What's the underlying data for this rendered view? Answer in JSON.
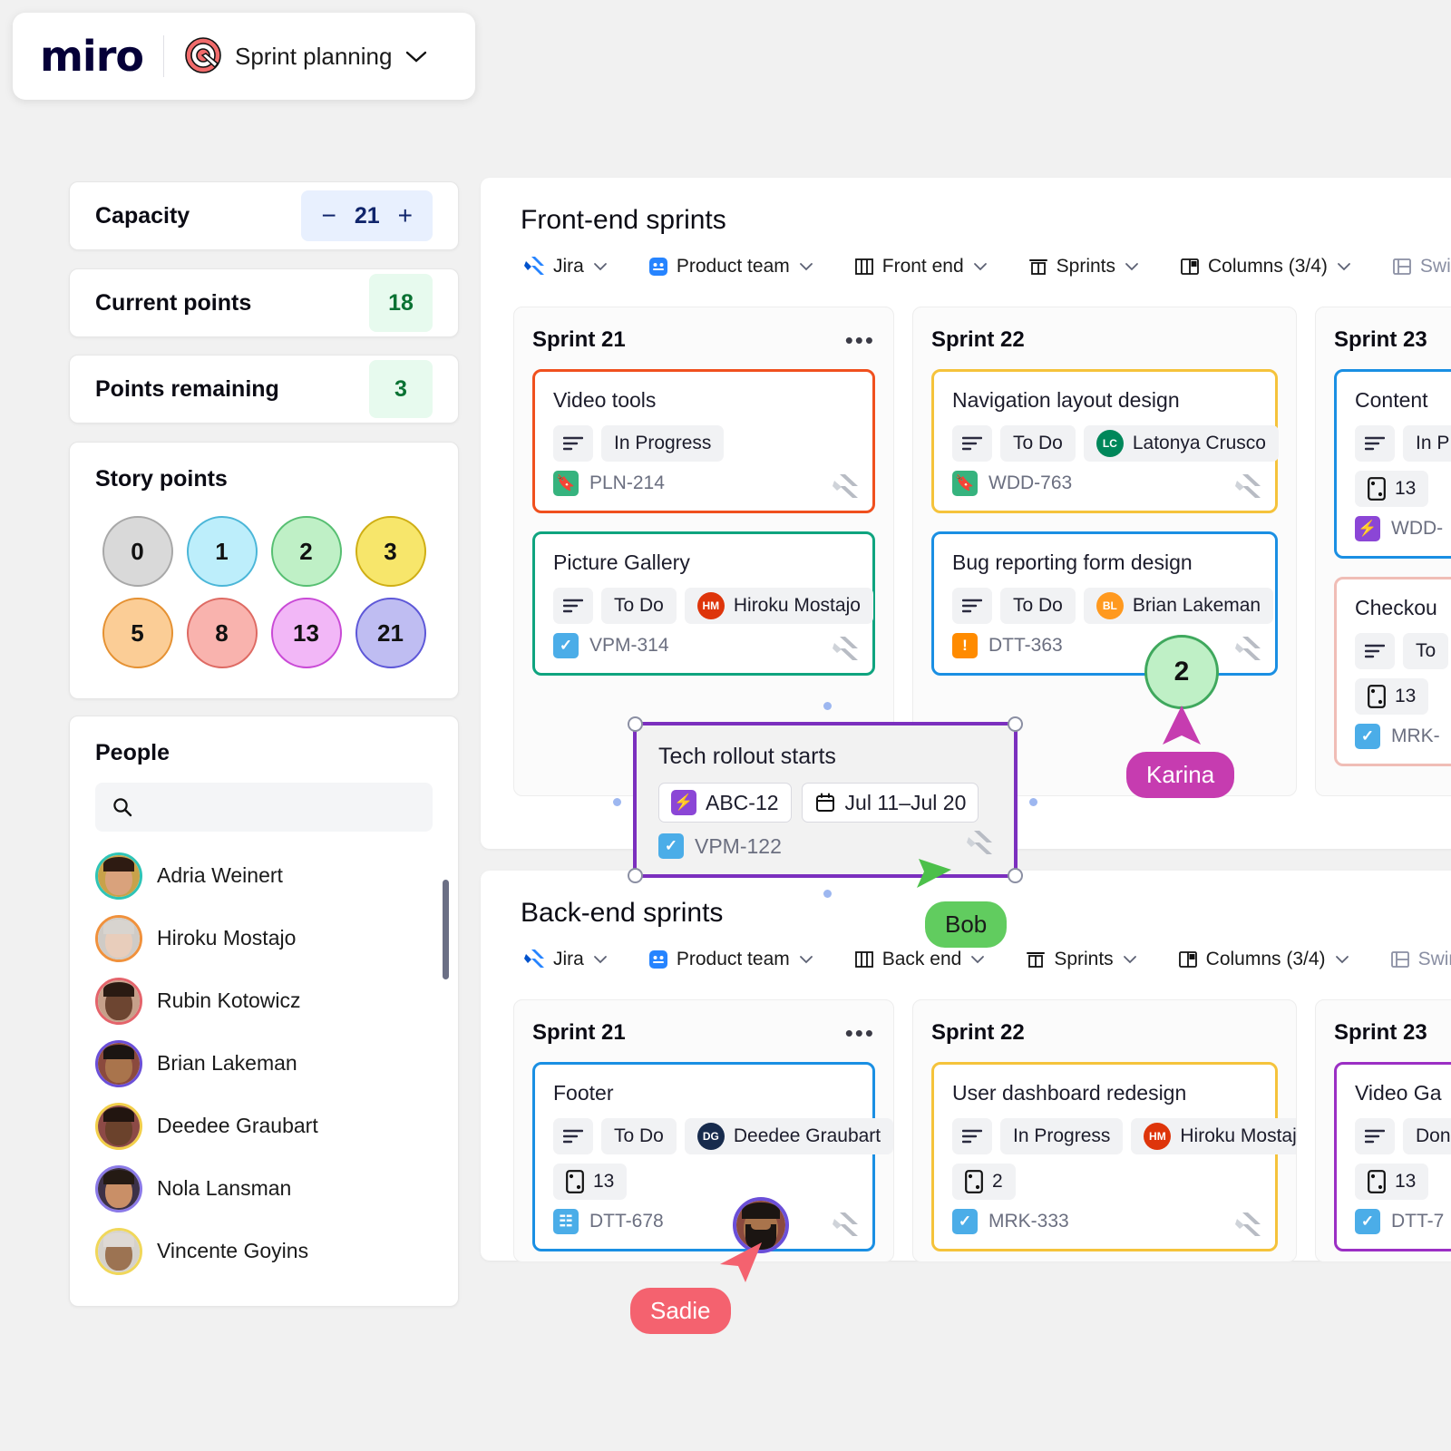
{
  "app": {
    "brand": "miro",
    "board_title": "Sprint planning",
    "board_icon": "target-icon",
    "chevron": "chevron-down-icon"
  },
  "sidebar": {
    "capacity": {
      "label": "Capacity",
      "value": "21",
      "minus": "−",
      "plus": "+"
    },
    "current_points": {
      "label": "Current points",
      "value": "18"
    },
    "points_remaining": {
      "label": "Points remaining",
      "value": "3"
    },
    "story_points": {
      "title": "Story points",
      "chips": [
        {
          "value": "0",
          "fill": "#d9d9d9",
          "stroke": "#a8a8a8"
        },
        {
          "value": "1",
          "fill": "#bdeefb",
          "stroke": "#4bb6d8"
        },
        {
          "value": "2",
          "fill": "#bff0c6",
          "stroke": "#57bf72"
        },
        {
          "value": "3",
          "fill": "#f7e66b",
          "stroke": "#cfae14"
        },
        {
          "value": "5",
          "fill": "#fbcd96",
          "stroke": "#e59132"
        },
        {
          "value": "8",
          "fill": "#f9b3ae",
          "stroke": "#de6a63"
        },
        {
          "value": "13",
          "fill": "#f2b7f7",
          "stroke": "#c94ad6"
        },
        {
          "value": "21",
          "fill": "#bfbdf2",
          "stroke": "#5d57d8"
        }
      ]
    },
    "people": {
      "title": "People",
      "search_placeholder": "",
      "search_value": "",
      "search_icon": "search-icon",
      "items": [
        {
          "name": "Adria Weinert",
          "ring": "#2ec4b6",
          "skin": "#d9a27c",
          "hair": "#2e1b12",
          "bg": "#c8a24a"
        },
        {
          "name": "Hiroku Mostajo",
          "ring": "#f0913c",
          "skin": "#e8cdbb",
          "hair": "#d8d4cf",
          "bg": "#cfcbc6"
        },
        {
          "name": "Rubin Kotowicz",
          "ring": "#e4646b",
          "skin": "#6d4531",
          "hair": "#2a1a12",
          "bg": "#c6a08a"
        },
        {
          "name": "Brian Lakeman",
          "ring": "#6b4fd8",
          "skin": "#a9744c",
          "hair": "#1b1512",
          "bg": "#8b4a3e"
        },
        {
          "name": "Deedee Graubart",
          "ring": "#f2cf4a",
          "skin": "#6b422c",
          "hair": "#221510",
          "bg": "#8c4a46"
        },
        {
          "name": "Nola Lansman",
          "ring": "#8b7ae8",
          "skin": "#c98f67",
          "hair": "#241a14",
          "bg": "#3c3147"
        },
        {
          "name": "Vincente Goyins",
          "ring": "#f0d75a",
          "skin": "#9c7352",
          "hair": "#ded9d4",
          "bg": "#d5d1cb"
        }
      ]
    }
  },
  "frames": [
    {
      "title": "Front-end sprints",
      "toolbar": [
        {
          "label": "Jira",
          "icon": "jira-icon",
          "muted": false
        },
        {
          "label": "Product team",
          "icon": "team-icon",
          "muted": false
        },
        {
          "label": "Front end",
          "icon": "board-icon",
          "muted": false
        },
        {
          "label": "Sprints",
          "icon": "sprints-icon",
          "muted": false
        },
        {
          "label": "Columns (3/4)",
          "icon": "columns-icon",
          "muted": false
        },
        {
          "label": "Swimlanes",
          "icon": "swimlanes-icon",
          "muted": true
        }
      ],
      "columns": [
        {
          "name": "Sprint 21",
          "menu": "•••",
          "cards": [
            {
              "title": "Video tools",
              "border": "#f0501e",
              "status": "In Progress",
              "assignee": null,
              "points": null,
              "key": "PLN-214",
              "key_icon": "story-icon",
              "key_icon_color": "#36b37e"
            },
            {
              "title": "Picture Gallery",
              "border": "#0fa47f",
              "status": "To Do",
              "assignee": {
                "name": "Hiroku Mostajo",
                "initials": "HM",
                "color": "#de350b"
              },
              "points": null,
              "key": "VPM-314",
              "key_icon": "task-icon",
              "key_icon_color": "#4bade8"
            }
          ]
        },
        {
          "name": "Sprint 22",
          "menu": "",
          "cards": [
            {
              "title": "Navigation layout design",
              "border": "#f5c33b",
              "status": "To Do",
              "assignee": {
                "name": "Latonya Crusco",
                "initials": "LC",
                "color": "#00875a"
              },
              "points": null,
              "key": "WDD-763",
              "key_icon": "story-icon",
              "key_icon_color": "#36b37e"
            },
            {
              "title": "Bug reporting form design",
              "border": "#1a8fe3",
              "status": "To Do",
              "assignee": {
                "name": "Brian Lakeman",
                "initials": "BL",
                "color": "#ff991f"
              },
              "points": null,
              "key": "DTT-363",
              "key_icon": "bug-icon",
              "key_icon_color": "#ff8b00"
            }
          ]
        },
        {
          "name": "Sprint 23",
          "menu": "",
          "cards": [
            {
              "title": "Content",
              "border": "#1a8fe3",
              "status": "In P",
              "assignee": null,
              "points": "13",
              "key": "WDD-",
              "key_icon": "epic-icon",
              "key_icon_color": "#8b46d6"
            },
            {
              "title": "Checkou",
              "border": "#f0bdb6",
              "status": "To",
              "assignee": null,
              "points": "13",
              "key": "MRK-",
              "key_icon": "task-icon",
              "key_icon_color": "#4bade8"
            }
          ]
        }
      ]
    },
    {
      "title": "Back-end sprints",
      "toolbar": [
        {
          "label": "Jira",
          "icon": "jira-icon",
          "muted": false
        },
        {
          "label": "Product team",
          "icon": "team-icon",
          "muted": false
        },
        {
          "label": "Back end",
          "icon": "board-icon",
          "muted": false
        },
        {
          "label": "Sprints",
          "icon": "sprints-icon",
          "muted": false
        },
        {
          "label": "Columns (3/4)",
          "icon": "columns-icon",
          "muted": false
        },
        {
          "label": "Swimlanes",
          "icon": "swimlanes-icon",
          "muted": true
        }
      ],
      "columns": [
        {
          "name": "Sprint 21",
          "menu": "•••",
          "cards": [
            {
              "title": "Footer",
              "border": "#1a8fe3",
              "status": "To Do",
              "assignee": {
                "name": "Deedee Graubart",
                "initials": "DG",
                "color": "#172b4d"
              },
              "points": "13",
              "key": "DTT-678",
              "key_icon": "subtask-icon",
              "key_icon_color": "#4bade8"
            }
          ]
        },
        {
          "name": "Sprint 22",
          "menu": "",
          "cards": [
            {
              "title": "User dashboard redesign",
              "border": "#f5c33b",
              "status": "In Progress",
              "assignee": {
                "name": "Hiroku Mostajo",
                "initials": "HM",
                "color": "#de350b"
              },
              "points": "2",
              "key": "MRK-333",
              "key_icon": "task-icon",
              "key_icon_color": "#4bade8"
            }
          ]
        },
        {
          "name": "Sprint 23",
          "menu": "",
          "cards": [
            {
              "title": "Video Ga",
              "border": "#9b2fc4",
              "status": "Don",
              "assignee": null,
              "points": "13",
              "key": "DTT-7",
              "key_icon": "task-icon",
              "key_icon_color": "#4bade8"
            }
          ]
        }
      ]
    }
  ],
  "selected_card": {
    "title": "Tech rollout starts",
    "epic_key": "ABC-12",
    "epic_icon": "epic-icon",
    "date_range": "Jul 11–Jul 20",
    "date_icon": "calendar-icon",
    "key": "VPM-122",
    "key_icon": "task-icon",
    "border": "#7b2fbe"
  },
  "collaborators": [
    {
      "name": "Karina",
      "color": "#c63cb0",
      "pointer_color": "#c63cb0"
    },
    {
      "name": "Bob",
      "color": "#61cc5f",
      "pointer_color": "#61cc5f"
    },
    {
      "name": "Sadie",
      "color": "#f4626f",
      "pointer_color": "#f4626f"
    }
  ],
  "dragged_token": {
    "value": "2",
    "fill": "#bff0c6",
    "stroke": "#3fa85d"
  }
}
